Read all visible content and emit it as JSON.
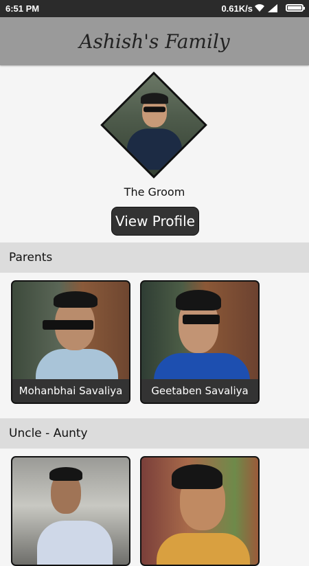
{
  "status_bar": {
    "time": "6:51 PM",
    "network_speed": "0.61K/s",
    "wifi_icon": "wifi-icon",
    "signal_icon": "signal-icon",
    "battery_icon": "battery-icon"
  },
  "header": {
    "title": "Ashish's Family"
  },
  "groom": {
    "caption": "The Groom",
    "button_label": "View Profile"
  },
  "sections": [
    {
      "title": "Parents",
      "members": [
        {
          "name": "Mohanbhai Savaliya"
        },
        {
          "name": "Geetaben Savaliya"
        }
      ]
    },
    {
      "title": "Uncle - Aunty",
      "members": [
        {
          "name": ""
        },
        {
          "name": ""
        }
      ]
    }
  ],
  "colors": {
    "header_bg": "#9a9a9a",
    "section_header_bg": "#dcdcdc",
    "button_bg": "#333333",
    "status_bar_bg": "#2b2b2b"
  }
}
